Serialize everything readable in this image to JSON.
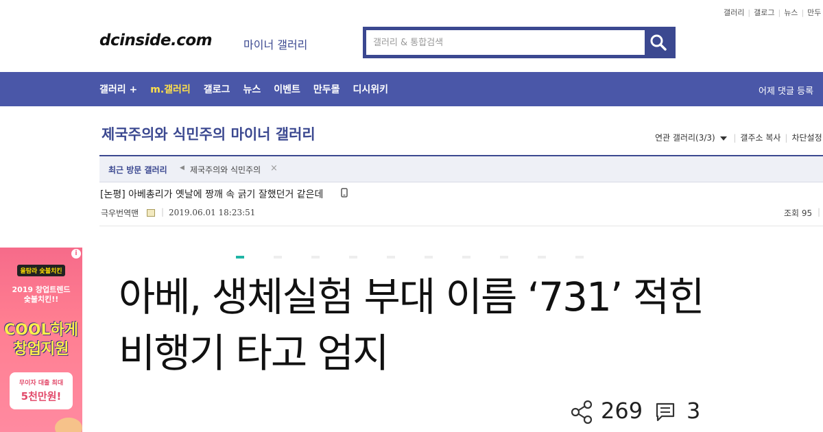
{
  "top_links": [
    "갤러리",
    "갤로그",
    "뉴스",
    "만두"
  ],
  "logo": {
    "text": "dcinside.com",
    "sub": "마이너 갤러리"
  },
  "search": {
    "placeholder": "갤러리 & 통합검색"
  },
  "nav": {
    "items": [
      "갤러리 +",
      "m.갤러리",
      "갤로그",
      "뉴스",
      "이벤트",
      "만두몰",
      "디시위키"
    ],
    "right": "어제 댓글 등록"
  },
  "gallery": {
    "title": "제국주의와 식민주의 마이너 갤러리",
    "tools": [
      "연관 갤러리(3/3)",
      "갤주소 복사",
      "차단설정"
    ]
  },
  "recent": {
    "label": "최근 방문 갤러리",
    "item": "제국주의와 식민주의"
  },
  "post": {
    "title": "[논평] 아베총리가 옛날에 짱깨 속 긁기 잘했던거 같은데",
    "author": "극우번역맨",
    "date": "2019.06.01 18:23:51",
    "views": "조회 95"
  },
  "carousel": {
    "count": 10,
    "active": 0
  },
  "article": {
    "headline": "아베, 생체실험 부대 이름 ‘731’ 적힌 비행기 타고 엄지",
    "shares": "269",
    "comments": "3"
  },
  "ad": {
    "info": "i",
    "brand": "올탐라 숯불치킨",
    "line1": "2019 창업트렌드",
    "line2": "숯불치킨!!",
    "cool1": "COOL하게",
    "cool2": "창업지원",
    "box1": "무이자 대출 최대",
    "box2": "5천만원!"
  },
  "colors": {
    "brand": "#3b4890",
    "nav_bg": "#4a57a8",
    "nav_highlight": "#ffe04b",
    "dot_active": "#1fb5a5"
  }
}
